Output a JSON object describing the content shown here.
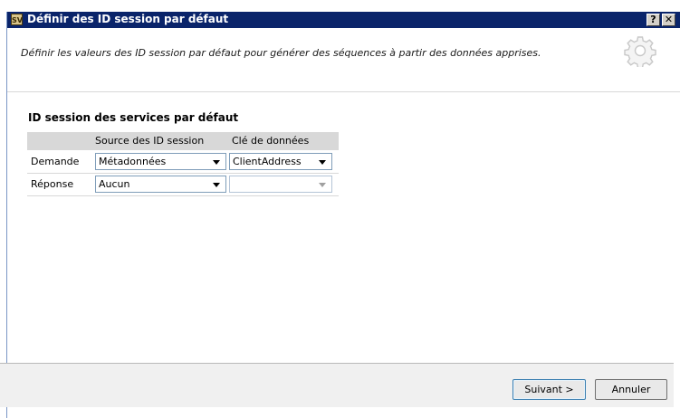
{
  "window": {
    "title": "Définir des ID session par défaut",
    "app_icon_label": "SV",
    "help_label": "?",
    "close_label": "✕"
  },
  "header": {
    "description": "Définir les valeurs des ID session par défaut pour générer des séquences à partir des données apprises.",
    "icon": "gear-icon"
  },
  "section": {
    "title": "ID session des services par défaut"
  },
  "grid": {
    "columns": [
      "Source des ID session",
      "Clé de données"
    ],
    "rows": [
      {
        "label": "Demande",
        "source": "Métadonnées",
        "key": "ClientAddress",
        "key_enabled": true
      },
      {
        "label": "Réponse",
        "source": "Aucun",
        "key": "",
        "key_enabled": false
      }
    ]
  },
  "footer": {
    "next_label": "Suivant >",
    "cancel_label": "Annuler"
  },
  "colors": {
    "titlebar": "#0a246a",
    "grid_header": "#d8d8d8",
    "input_border": "#7f9db9"
  }
}
